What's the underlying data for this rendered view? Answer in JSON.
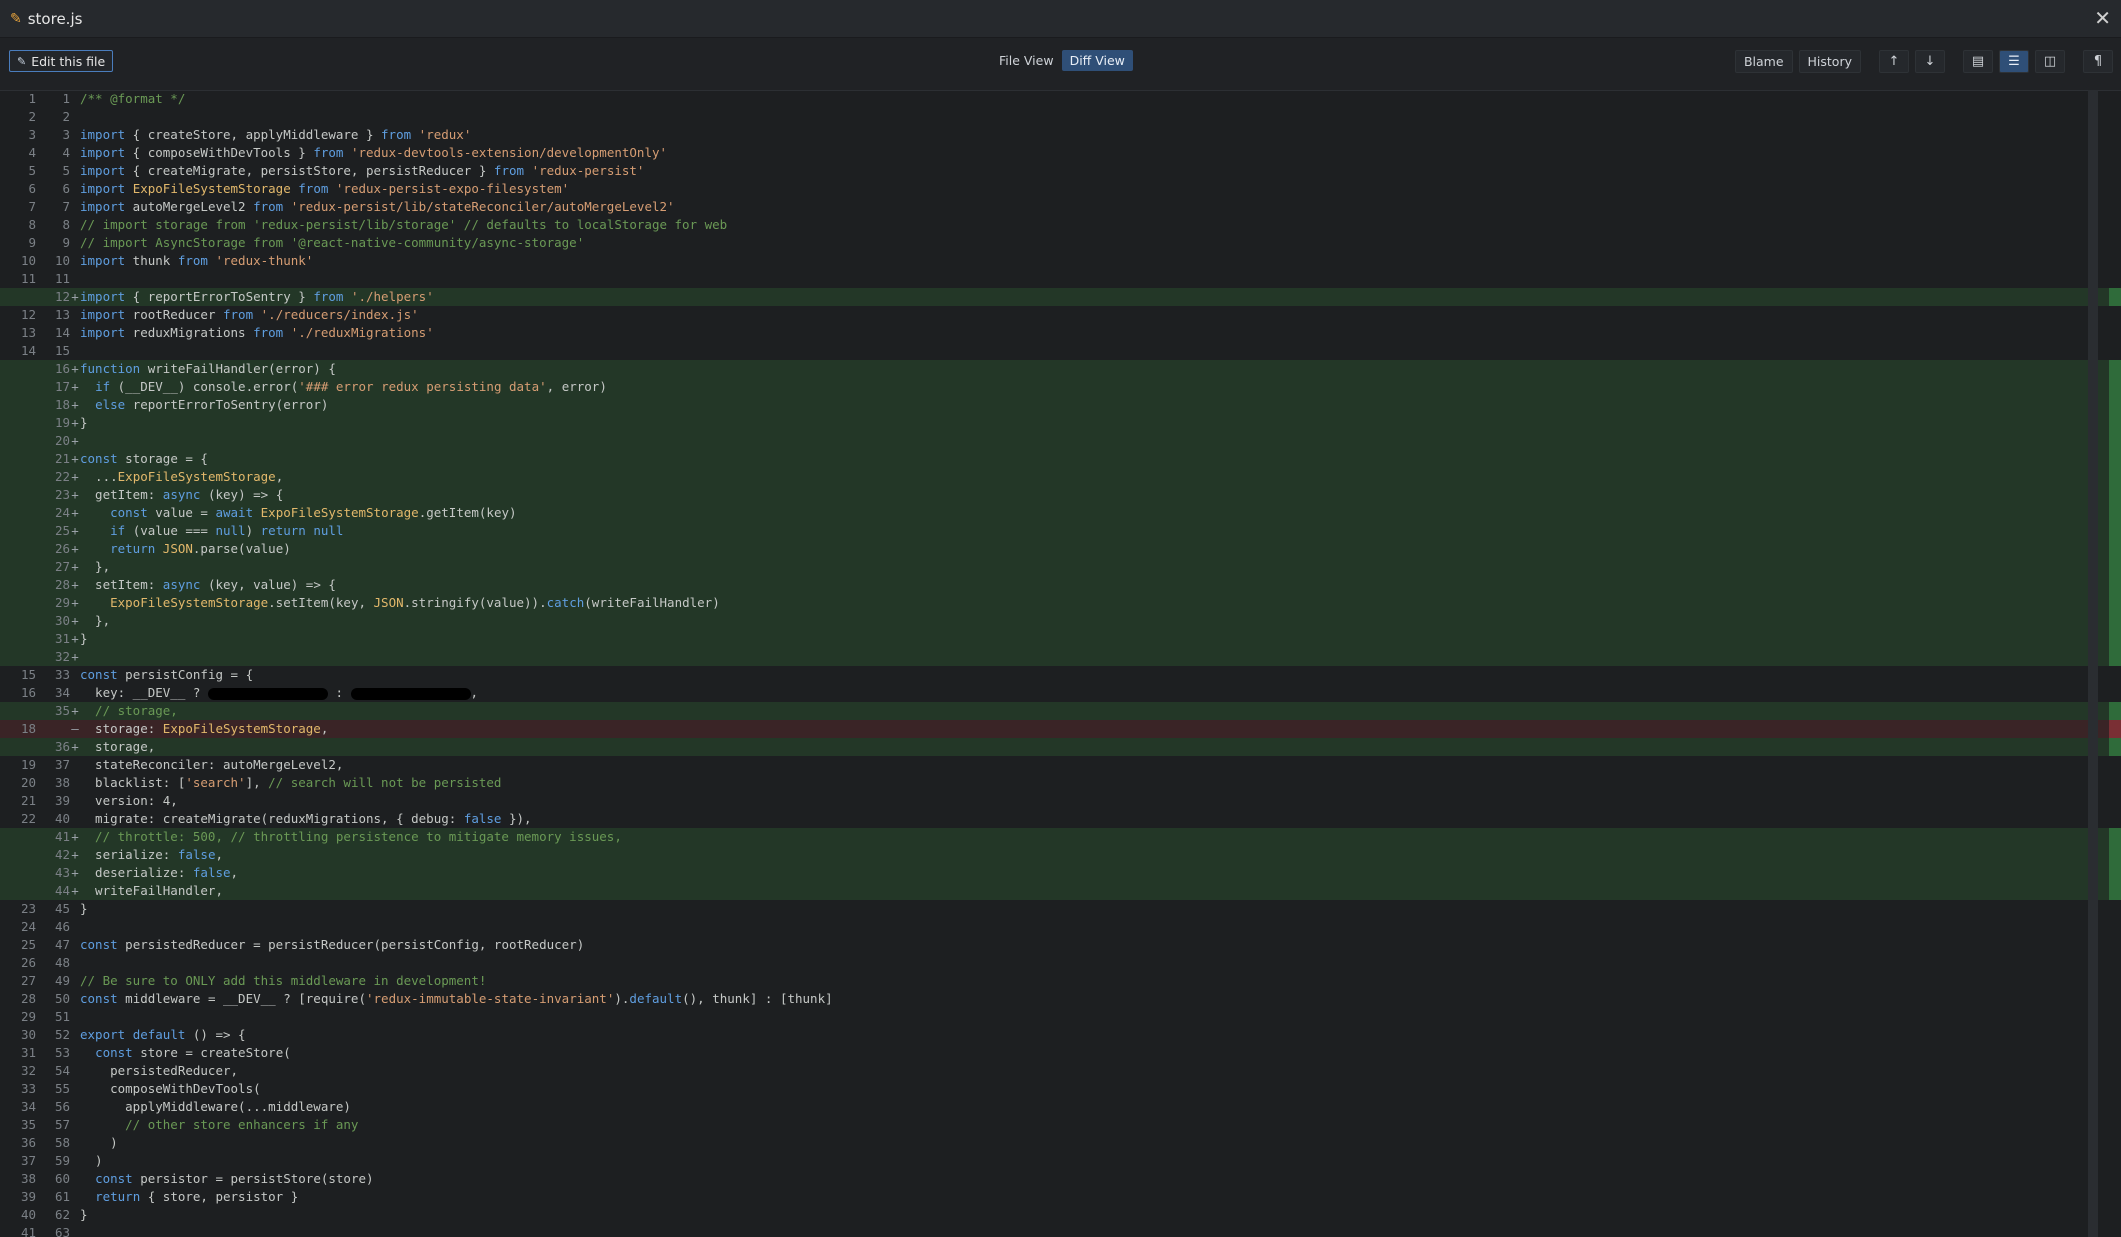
{
  "window": {
    "title": "store.js",
    "close_label": "✕"
  },
  "toolbar": {
    "edit_label": "Edit this file",
    "file_view": "File View",
    "diff_view": "Diff View",
    "blame": "Blame",
    "history": "History"
  },
  "lines": [
    {
      "ln1": "1",
      "ln2": "1",
      "type": "ctx",
      "tokens": [
        [
          "c",
          "/** @format */"
        ]
      ]
    },
    {
      "ln1": "2",
      "ln2": "2",
      "type": "ctx",
      "tokens": []
    },
    {
      "ln1": "3",
      "ln2": "3",
      "type": "ctx",
      "tokens": [
        [
          "k",
          "import"
        ],
        [
          "p",
          " { createStore, applyMiddleware } "
        ],
        [
          "k",
          "from"
        ],
        [
          "p",
          " "
        ],
        [
          "s",
          "'redux'"
        ]
      ]
    },
    {
      "ln1": "4",
      "ln2": "4",
      "type": "ctx",
      "tokens": [
        [
          "k",
          "import"
        ],
        [
          "p",
          " { composeWithDevTools } "
        ],
        [
          "k",
          "from"
        ],
        [
          "p",
          " "
        ],
        [
          "s",
          "'redux-devtools-extension/developmentOnly'"
        ]
      ]
    },
    {
      "ln1": "5",
      "ln2": "5",
      "type": "ctx",
      "tokens": [
        [
          "k",
          "import"
        ],
        [
          "p",
          " { createMigrate, persistStore, persistReducer } "
        ],
        [
          "k",
          "from"
        ],
        [
          "p",
          " "
        ],
        [
          "s",
          "'redux-persist'"
        ]
      ]
    },
    {
      "ln1": "6",
      "ln2": "6",
      "type": "ctx",
      "tokens": [
        [
          "k",
          "import"
        ],
        [
          "p",
          " "
        ],
        [
          "t",
          "ExpoFileSystemStorage"
        ],
        [
          "p",
          " "
        ],
        [
          "k",
          "from"
        ],
        [
          "p",
          " "
        ],
        [
          "s",
          "'redux-persist-expo-filesystem'"
        ]
      ]
    },
    {
      "ln1": "7",
      "ln2": "7",
      "type": "ctx",
      "tokens": [
        [
          "k",
          "import"
        ],
        [
          "p",
          " autoMergeLevel2 "
        ],
        [
          "k",
          "from"
        ],
        [
          "p",
          " "
        ],
        [
          "s",
          "'redux-persist/lib/stateReconciler/autoMergeLevel2'"
        ]
      ]
    },
    {
      "ln1": "8",
      "ln2": "8",
      "type": "ctx",
      "tokens": [
        [
          "c",
          "// import storage from 'redux-persist/lib/storage' // defaults to localStorage for web"
        ]
      ]
    },
    {
      "ln1": "9",
      "ln2": "9",
      "type": "ctx",
      "tokens": [
        [
          "c",
          "// import AsyncStorage from '@react-native-community/async-storage'"
        ]
      ]
    },
    {
      "ln1": "10",
      "ln2": "10",
      "type": "ctx",
      "tokens": [
        [
          "k",
          "import"
        ],
        [
          "p",
          " thunk "
        ],
        [
          "k",
          "from"
        ],
        [
          "p",
          " "
        ],
        [
          "s",
          "'redux-thunk'"
        ]
      ]
    },
    {
      "ln1": "11",
      "ln2": "11",
      "type": "ctx",
      "tokens": []
    },
    {
      "ln1": "",
      "ln2": "12",
      "type": "add",
      "tokens": [
        [
          "k",
          "import"
        ],
        [
          "p",
          " { reportErrorToSentry } "
        ],
        [
          "k",
          "from"
        ],
        [
          "p",
          " "
        ],
        [
          "s",
          "'./helpers'"
        ]
      ]
    },
    {
      "ln1": "12",
      "ln2": "13",
      "type": "ctx",
      "tokens": [
        [
          "k",
          "import"
        ],
        [
          "p",
          " rootReducer "
        ],
        [
          "k",
          "from"
        ],
        [
          "p",
          " "
        ],
        [
          "s",
          "'./reducers/index.js'"
        ]
      ]
    },
    {
      "ln1": "13",
      "ln2": "14",
      "type": "ctx",
      "tokens": [
        [
          "k",
          "import"
        ],
        [
          "p",
          " reduxMigrations "
        ],
        [
          "k",
          "from"
        ],
        [
          "p",
          " "
        ],
        [
          "s",
          "'./reduxMigrations'"
        ]
      ]
    },
    {
      "ln1": "14",
      "ln2": "15",
      "type": "ctx",
      "tokens": []
    },
    {
      "ln1": "",
      "ln2": "16",
      "type": "add",
      "tokens": [
        [
          "k",
          "function"
        ],
        [
          "p",
          " writeFailHandler(error) {"
        ]
      ]
    },
    {
      "ln1": "",
      "ln2": "17",
      "type": "add",
      "tokens": [
        [
          "p",
          "  "
        ],
        [
          "k",
          "if"
        ],
        [
          "p",
          " (__DEV__) console.error("
        ],
        [
          "s",
          "'### error redux persisting data'"
        ],
        [
          "p",
          ", error)"
        ]
      ]
    },
    {
      "ln1": "",
      "ln2": "18",
      "type": "add",
      "tokens": [
        [
          "p",
          "  "
        ],
        [
          "k",
          "else"
        ],
        [
          "p",
          " reportErrorToSentry(error)"
        ]
      ]
    },
    {
      "ln1": "",
      "ln2": "19",
      "type": "add",
      "tokens": [
        [
          "p",
          "}"
        ]
      ]
    },
    {
      "ln1": "",
      "ln2": "20",
      "type": "add",
      "tokens": []
    },
    {
      "ln1": "",
      "ln2": "21",
      "type": "add",
      "tokens": [
        [
          "k",
          "const"
        ],
        [
          "p",
          " storage = {"
        ]
      ]
    },
    {
      "ln1": "",
      "ln2": "22",
      "type": "add",
      "tokens": [
        [
          "p",
          "  ..."
        ],
        [
          "t",
          "ExpoFileSystemStorage"
        ],
        [
          "p",
          ","
        ]
      ]
    },
    {
      "ln1": "",
      "ln2": "23",
      "type": "add",
      "tokens": [
        [
          "p",
          "  getItem: "
        ],
        [
          "k",
          "async"
        ],
        [
          "p",
          " (key) => {"
        ]
      ]
    },
    {
      "ln1": "",
      "ln2": "24",
      "type": "add",
      "tokens": [
        [
          "p",
          "    "
        ],
        [
          "k",
          "const"
        ],
        [
          "p",
          " value = "
        ],
        [
          "k",
          "await"
        ],
        [
          "p",
          " "
        ],
        [
          "t",
          "ExpoFileSystemStorage"
        ],
        [
          "p",
          ".getItem(key)"
        ]
      ]
    },
    {
      "ln1": "",
      "ln2": "25",
      "type": "add",
      "tokens": [
        [
          "p",
          "    "
        ],
        [
          "k",
          "if"
        ],
        [
          "p",
          " (value === "
        ],
        [
          "k",
          "null"
        ],
        [
          "p",
          ") "
        ],
        [
          "k",
          "return"
        ],
        [
          "p",
          " "
        ],
        [
          "k",
          "null"
        ]
      ]
    },
    {
      "ln1": "",
      "ln2": "26",
      "type": "add",
      "tokens": [
        [
          "p",
          "    "
        ],
        [
          "k",
          "return"
        ],
        [
          "p",
          " "
        ],
        [
          "t",
          "JSON"
        ],
        [
          "p",
          ".parse(value)"
        ]
      ]
    },
    {
      "ln1": "",
      "ln2": "27",
      "type": "add",
      "tokens": [
        [
          "p",
          "  },"
        ]
      ]
    },
    {
      "ln1": "",
      "ln2": "28",
      "type": "add",
      "tokens": [
        [
          "p",
          "  setItem: "
        ],
        [
          "k",
          "async"
        ],
        [
          "p",
          " (key, value) => {"
        ]
      ]
    },
    {
      "ln1": "",
      "ln2": "29",
      "type": "add",
      "tokens": [
        [
          "p",
          "    "
        ],
        [
          "t",
          "ExpoFileSystemStorage"
        ],
        [
          "p",
          ".setItem(key, "
        ],
        [
          "t",
          "JSON"
        ],
        [
          "p",
          ".stringify(value))."
        ],
        [
          "k",
          "catch"
        ],
        [
          "p",
          "(writeFailHandler)"
        ]
      ]
    },
    {
      "ln1": "",
      "ln2": "30",
      "type": "add",
      "tokens": [
        [
          "p",
          "  },"
        ]
      ]
    },
    {
      "ln1": "",
      "ln2": "31",
      "type": "add",
      "tokens": [
        [
          "p",
          "}"
        ]
      ]
    },
    {
      "ln1": "",
      "ln2": "32",
      "type": "add",
      "tokens": []
    },
    {
      "ln1": "15",
      "ln2": "33",
      "type": "ctx",
      "tokens": [
        [
          "k",
          "const"
        ],
        [
          "p",
          " persistConfig = {"
        ]
      ]
    },
    {
      "ln1": "16",
      "ln2": "34",
      "type": "ctx",
      "tokens": [
        [
          "p",
          "  key: __DEV__ ? "
        ],
        [
          "r",
          ""
        ],
        [
          "p",
          " : "
        ],
        [
          "r",
          ""
        ],
        [
          "p",
          ","
        ]
      ]
    },
    {
      "ln1": "",
      "ln2": "35",
      "type": "add",
      "tokens": [
        [
          "c",
          "  // storage,"
        ]
      ]
    },
    {
      "ln1": "18",
      "ln2": "",
      "type": "del",
      "tokens": [
        [
          "p",
          "  storage: "
        ],
        [
          "t",
          "ExpoFileSystemStorage"
        ],
        [
          "p",
          ","
        ]
      ]
    },
    {
      "ln1": "",
      "ln2": "36",
      "type": "add",
      "tokens": [
        [
          "p",
          "  storage,"
        ]
      ]
    },
    {
      "ln1": "19",
      "ln2": "37",
      "type": "ctx",
      "tokens": [
        [
          "p",
          "  stateReconciler: autoMergeLevel2,"
        ]
      ]
    },
    {
      "ln1": "20",
      "ln2": "38",
      "type": "ctx",
      "tokens": [
        [
          "p",
          "  blacklist: ["
        ],
        [
          "s",
          "'search'"
        ],
        [
          "p",
          "], "
        ],
        [
          "c",
          "// search will not be persisted"
        ]
      ]
    },
    {
      "ln1": "21",
      "ln2": "39",
      "type": "ctx",
      "tokens": [
        [
          "p",
          "  version: 4,"
        ]
      ]
    },
    {
      "ln1": "22",
      "ln2": "40",
      "type": "ctx",
      "tokens": [
        [
          "p",
          "  migrate: createMigrate(reduxMigrations, { debug: "
        ],
        [
          "k",
          "false"
        ],
        [
          "p",
          " }),"
        ]
      ]
    },
    {
      "ln1": "",
      "ln2": "41",
      "type": "add",
      "tokens": [
        [
          "c",
          "  // throttle: 500, // throttling persistence to mitigate memory issues,"
        ]
      ]
    },
    {
      "ln1": "",
      "ln2": "42",
      "type": "add",
      "tokens": [
        [
          "p",
          "  serialize: "
        ],
        [
          "k",
          "false"
        ],
        [
          "p",
          ","
        ]
      ]
    },
    {
      "ln1": "",
      "ln2": "43",
      "type": "add",
      "tokens": [
        [
          "p",
          "  deserialize: "
        ],
        [
          "k",
          "false"
        ],
        [
          "p",
          ","
        ]
      ]
    },
    {
      "ln1": "",
      "ln2": "44",
      "type": "add",
      "tokens": [
        [
          "p",
          "  writeFailHandler,"
        ]
      ]
    },
    {
      "ln1": "23",
      "ln2": "45",
      "type": "ctx",
      "tokens": [
        [
          "p",
          "}"
        ]
      ]
    },
    {
      "ln1": "24",
      "ln2": "46",
      "type": "ctx",
      "tokens": []
    },
    {
      "ln1": "25",
      "ln2": "47",
      "type": "ctx",
      "tokens": [
        [
          "k",
          "const"
        ],
        [
          "p",
          " persistedReducer = persistReducer(persistConfig, rootReducer)"
        ]
      ]
    },
    {
      "ln1": "26",
      "ln2": "48",
      "type": "ctx",
      "tokens": []
    },
    {
      "ln1": "27",
      "ln2": "49",
      "type": "ctx",
      "tokens": [
        [
          "c",
          "// Be sure to ONLY add this middleware in development!"
        ]
      ]
    },
    {
      "ln1": "28",
      "ln2": "50",
      "type": "ctx",
      "tokens": [
        [
          "k",
          "const"
        ],
        [
          "p",
          " middleware = __DEV__ ? [require("
        ],
        [
          "s",
          "'redux-immutable-state-invariant'"
        ],
        [
          "p",
          ")."
        ],
        [
          "k",
          "default"
        ],
        [
          "p",
          "(), thunk] : [thunk]"
        ]
      ]
    },
    {
      "ln1": "29",
      "ln2": "51",
      "type": "ctx",
      "tokens": []
    },
    {
      "ln1": "30",
      "ln2": "52",
      "type": "ctx",
      "tokens": [
        [
          "k",
          "export"
        ],
        [
          "p",
          " "
        ],
        [
          "k",
          "default"
        ],
        [
          "p",
          " () => {"
        ]
      ]
    },
    {
      "ln1": "31",
      "ln2": "53",
      "type": "ctx",
      "tokens": [
        [
          "p",
          "  "
        ],
        [
          "k",
          "const"
        ],
        [
          "p",
          " store = createStore("
        ]
      ]
    },
    {
      "ln1": "32",
      "ln2": "54",
      "type": "ctx",
      "tokens": [
        [
          "p",
          "    persistedReducer,"
        ]
      ]
    },
    {
      "ln1": "33",
      "ln2": "55",
      "type": "ctx",
      "tokens": [
        [
          "p",
          "    composeWithDevTools("
        ]
      ]
    },
    {
      "ln1": "34",
      "ln2": "56",
      "type": "ctx",
      "tokens": [
        [
          "p",
          "      applyMiddleware(...middleware)"
        ]
      ]
    },
    {
      "ln1": "35",
      "ln2": "57",
      "type": "ctx",
      "tokens": [
        [
          "c",
          "      // other store enhancers if any"
        ]
      ]
    },
    {
      "ln1": "36",
      "ln2": "58",
      "type": "ctx",
      "tokens": [
        [
          "p",
          "    )"
        ]
      ]
    },
    {
      "ln1": "37",
      "ln2": "59",
      "type": "ctx",
      "tokens": [
        [
          "p",
          "  )"
        ]
      ]
    },
    {
      "ln1": "38",
      "ln2": "60",
      "type": "ctx",
      "tokens": [
        [
          "p",
          "  "
        ],
        [
          "k",
          "const"
        ],
        [
          "p",
          " persistor = persistStore(store)"
        ]
      ]
    },
    {
      "ln1": "39",
      "ln2": "61",
      "type": "ctx",
      "tokens": [
        [
          "p",
          "  "
        ],
        [
          "k",
          "return"
        ],
        [
          "p",
          " { store, persistor }"
        ]
      ]
    },
    {
      "ln1": "40",
      "ln2": "62",
      "type": "ctx",
      "tokens": [
        [
          "p",
          "}"
        ]
      ]
    },
    {
      "ln1": "41",
      "ln2": "63",
      "type": "ctx",
      "tokens": []
    }
  ]
}
